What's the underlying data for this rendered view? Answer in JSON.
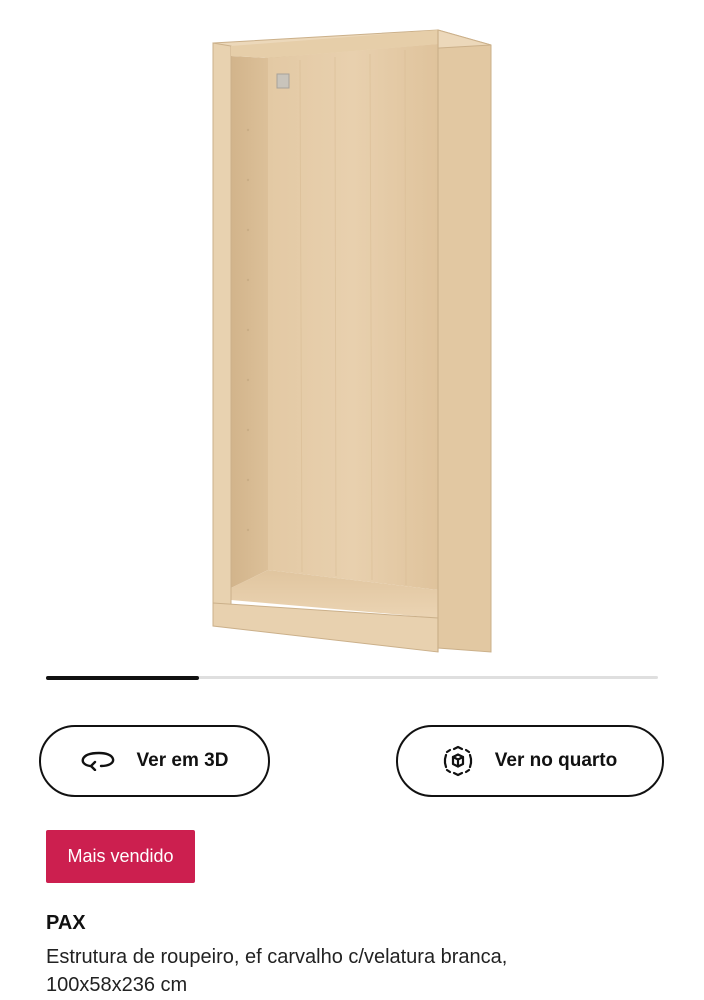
{
  "gallery": {
    "progress_fraction": 0.25
  },
  "actions": {
    "view_3d_label": "Ver em 3D",
    "view_in_room_label": "Ver no quarto"
  },
  "badge": {
    "label": "Mais vendido",
    "color": "#cc1f4f"
  },
  "product": {
    "name": "PAX",
    "description_line1": "Estrutura de roupeiro, ef carvalho c/velatura branca,",
    "description_line2": "100x58x236 cm"
  },
  "icons": {
    "view_3d": "rotate-3d-icon",
    "view_in_room": "augmented-reality-icon"
  }
}
